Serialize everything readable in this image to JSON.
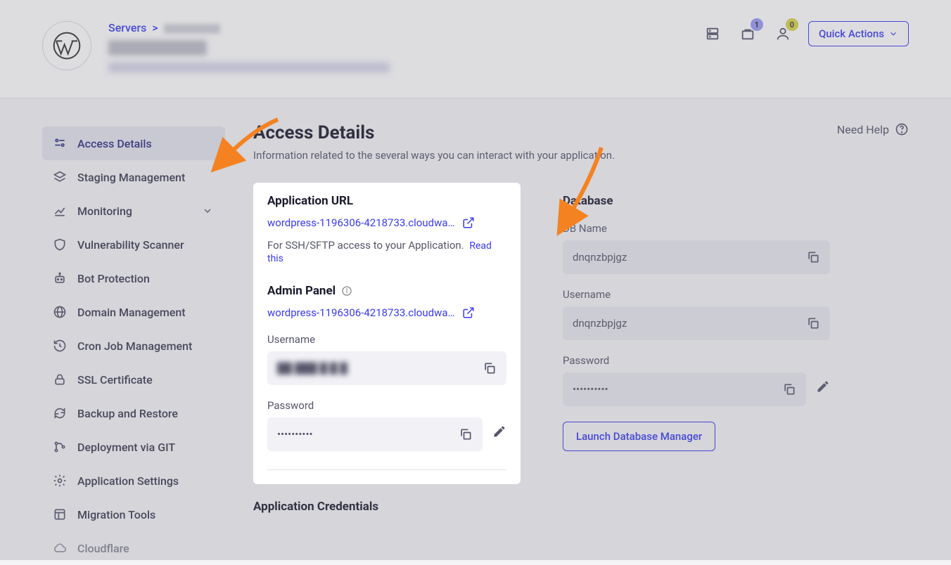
{
  "breadcrumb": {
    "label": "Servers",
    "sep": ">"
  },
  "topActions": {
    "badge1": "1",
    "badge2": "0",
    "quick": "Quick Actions"
  },
  "sidebar": {
    "items": [
      {
        "label": "Access Details",
        "icon": "sliders-icon"
      },
      {
        "label": "Staging Management",
        "icon": "layers-icon"
      },
      {
        "label": "Monitoring",
        "icon": "chart-icon",
        "expandable": true
      },
      {
        "label": "Vulnerability Scanner",
        "icon": "shield-icon"
      },
      {
        "label": "Bot Protection",
        "icon": "robot-icon"
      },
      {
        "label": "Domain Management",
        "icon": "globe-icon"
      },
      {
        "label": "Cron Job Management",
        "icon": "history-icon"
      },
      {
        "label": "SSL Certificate",
        "icon": "lock-icon"
      },
      {
        "label": "Backup and Restore",
        "icon": "refresh-icon"
      },
      {
        "label": "Deployment via GIT",
        "icon": "git-icon"
      },
      {
        "label": "Application Settings",
        "icon": "gear-icon"
      },
      {
        "label": "Migration Tools",
        "icon": "migrate-icon"
      },
      {
        "label": "Cloudflare",
        "icon": "cloud-icon"
      }
    ]
  },
  "main": {
    "title": "Access Details",
    "subtitle": "Information related to the several ways you can interact with your application.",
    "help": "Need Help"
  },
  "appUrl": {
    "heading": "Application URL",
    "url": "wordpress-1196306-4218733.cloudwa…",
    "sshText": "For SSH/SFTP access to your Application.",
    "readThis": "Read this"
  },
  "adminPanel": {
    "heading": "Admin Panel",
    "url": "wordpress-1196306-4218733.cloudwa…",
    "userLabel": "Username",
    "userValue": "██ ███ █ █ █",
    "passLabel": "Password",
    "passValue": "••••••••••"
  },
  "database": {
    "heading": "Database",
    "nameLabel": "DB Name",
    "nameValue": "dnqnzbpjgz",
    "userLabel": "Username",
    "userValue": "dnqnzbpjgz",
    "passLabel": "Password",
    "passValue": "••••••••••",
    "launch": "Launch Database Manager"
  },
  "credentials": {
    "heading": "Application Credentials"
  }
}
